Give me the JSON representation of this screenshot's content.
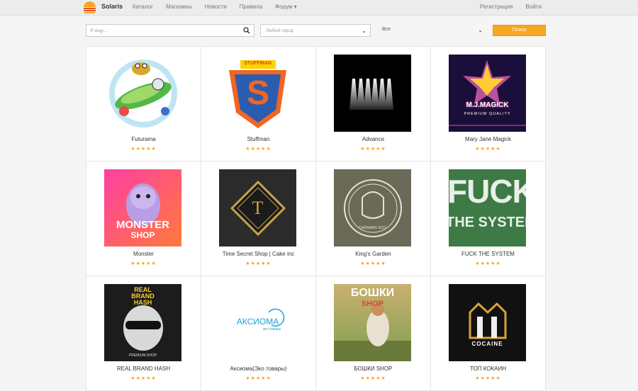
{
  "header": {
    "brand": "Solaris",
    "nav": [
      "Каталог",
      "Магазины",
      "Новости",
      "Правила",
      "Форум ▾"
    ],
    "register": "Регистрация",
    "login": "Войти"
  },
  "filters": {
    "search_placeholder": "Я ищу...",
    "city_value": "Любой город",
    "category_value": "Все",
    "find_button": "Поиск"
  },
  "shops": [
    {
      "name": "Futurama",
      "rating": "★★★★★",
      "icon": "futurama-logo"
    },
    {
      "name": "Stuffman",
      "rating": "★★★★★",
      "icon": "stuffman-logo",
      "label": "STUFFMAN"
    },
    {
      "name": "Advance",
      "rating": "★★★★★",
      "icon": "advance-logo"
    },
    {
      "name": "Mary Jane Magick",
      "rating": "★★★★★",
      "icon": "mjm-logo",
      "label": "M.J.MAGICK",
      "sub": "PREMIUM QUALITY"
    },
    {
      "name": "Monster",
      "rating": "★★★★★",
      "icon": "monster-logo",
      "label": "MONSTER",
      "sub": "SHOP"
    },
    {
      "name": "Time Secret Shop | Cake inc",
      "rating": "★★★★★",
      "icon": "time-secret-logo",
      "label": "T"
    },
    {
      "name": "King's Garden",
      "rating": "★★★★★",
      "icon": "kings-garden-logo",
      "label": "CANNABIS 2021"
    },
    {
      "name": "FUCK THE SYSTEM",
      "rating": "★★★★★",
      "icon": "fts-logo",
      "label": "FUCK",
      "sub": "THE SYSTEM"
    },
    {
      "name": "REAL BRAND HASH",
      "rating": "★★★★★",
      "icon": "rbh-logo",
      "label": "REAL BRAND HASH",
      "sub": "PREMIUM SHOP"
    },
    {
      "name": "Аксиома(Эко товары)",
      "rating": "★★★★★",
      "icon": "aksioma-logo",
      "label": "АКСИОМА",
      "sub": "эко товары"
    },
    {
      "name": "БОШКИ SHOP",
      "rating": "★★★★★",
      "icon": "boshki-logo",
      "label": "БОШКИ",
      "sub": "SHOP"
    },
    {
      "name": "ТОП КОКАИН",
      "rating": "★★★★★",
      "icon": "top-cocaine-logo",
      "label": "COCAINE"
    }
  ],
  "colors": {
    "accent": "#f5a623",
    "topbar": "#ececec",
    "background": "#f5f5f5"
  }
}
